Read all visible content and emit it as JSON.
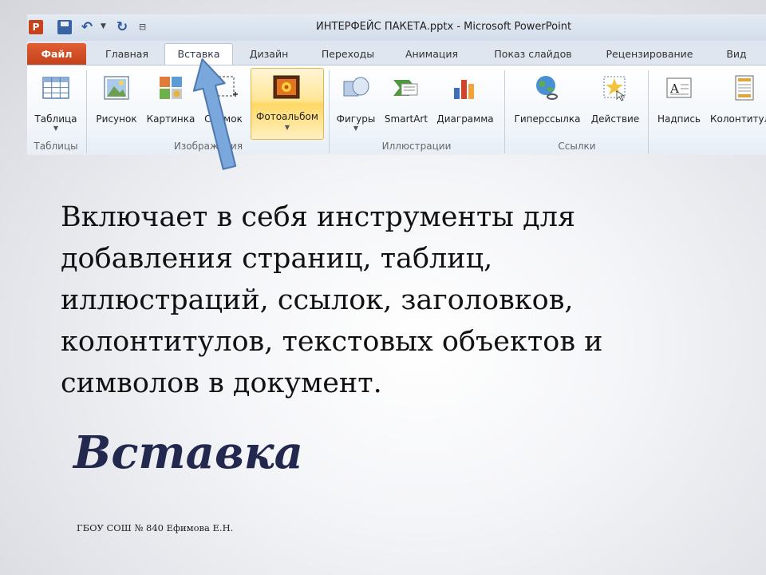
{
  "window": {
    "title": "ИНТЕРФЕЙС ПАКЕТА.pptx - Microsoft PowerPoint",
    "app_icon_letter": "P"
  },
  "tabs": [
    "Файл",
    "Главная",
    "Вставка",
    "Дизайн",
    "Переходы",
    "Анимация",
    "Показ слайдов",
    "Рецензирование",
    "Вид"
  ],
  "active_tab": "Вставка",
  "ribbon": {
    "buttons": {
      "table": "Таблица",
      "picture": "Рисунок",
      "clipart": "Картинка",
      "screenshot": "Снимок",
      "photo_album": "Фотоальбом",
      "shapes": "Фигуры",
      "smartart": "SmartArt",
      "chart": "Диаграмма",
      "hyperlink": "Гиперссылка",
      "action": "Действие",
      "textbox": "Надпись",
      "header_footer": "Колонтитулы"
    },
    "groups": {
      "tables": "Таблицы",
      "images": "Изображения",
      "illustrations": "Иллюстрации",
      "links": "Ссылки"
    }
  },
  "slide": {
    "body_lines": [
      "Включает в себя инструменты для",
      "добавления страниц, таблиц,",
      "иллюстраций, ссылок, заголовков,",
      "колонтитулов, текстовых объектов и",
      "символов в документ."
    ],
    "title": "Вставка",
    "footer": "ГБОУ СОШ № 840 Ефимова Е.Н."
  },
  "colors": {
    "file_tab": "#c3431c",
    "arrow": "#6f9fd8",
    "title": "#23284f"
  }
}
